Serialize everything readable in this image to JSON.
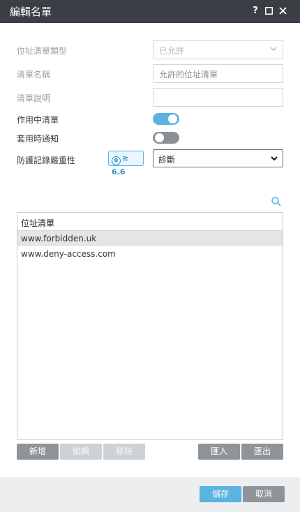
{
  "window": {
    "title": "編輯名單",
    "help_label": "?",
    "maximize_label": "☐",
    "close_label": "✕"
  },
  "form": {
    "list_type": {
      "label": "位址清單類型",
      "value": "已允許"
    },
    "list_name": {
      "label": "清單名稱",
      "value": "允許的位址清單"
    },
    "list_description": {
      "label": "清單說明",
      "value": ""
    },
    "active_list": {
      "label": "作用中清單",
      "enabled": true
    },
    "notify_on_apply": {
      "label": "套用時通知",
      "enabled": false
    },
    "log_severity": {
      "label": "防護記錄嚴重性",
      "badge_icon": "e",
      "badge_text": "≥ 6.6",
      "value": "診斷"
    }
  },
  "address_list": {
    "header": "位址清單",
    "rows": [
      {
        "address": "www.forbidden.uk",
        "selected": true
      },
      {
        "address": "www.deny-access.com",
        "selected": false
      }
    ]
  },
  "list_actions": {
    "add_label": "新增",
    "edit_label": "編輯",
    "remove_label": "移除",
    "import_label": "匯入",
    "export_label": "匯出"
  },
  "footer": {
    "save_label": "儲存",
    "cancel_label": "取消"
  },
  "icons": {
    "search": "search-icon",
    "chevron": "chevron-down-icon",
    "product_badge": "product-e-icon"
  },
  "colors": {
    "titlebar": "#3b3f45",
    "accent": "#5ab3e0",
    "button_gray": "#8f9499",
    "button_disabled": "#cfd2d5",
    "footer": "#eceef0"
  }
}
